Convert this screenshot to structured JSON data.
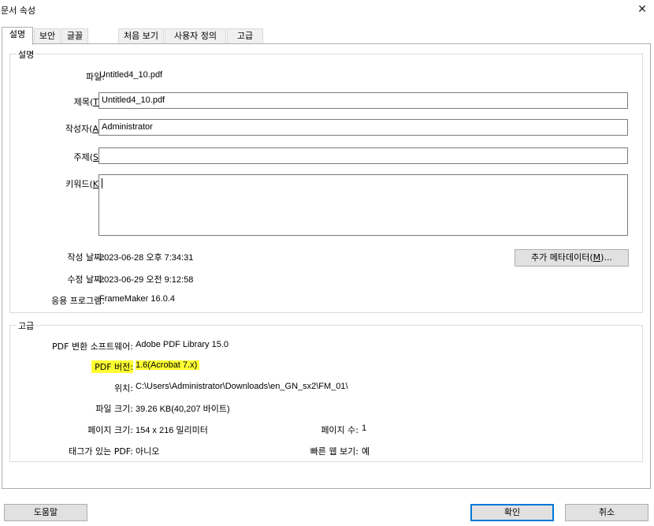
{
  "window": {
    "title": "문서 속성",
    "close_glyph": "✕"
  },
  "tabs": [
    {
      "label": "설명",
      "active": true
    },
    {
      "label": "보안"
    },
    {
      "label": "글꼴"
    },
    {
      "label": "처음 보기"
    },
    {
      "label": "사용자 정의"
    },
    {
      "label": "고급"
    }
  ],
  "description": {
    "group_title": "설명",
    "file_label": "파일:",
    "file_value": "Untitled4_10.pdf",
    "title_label_pre": "제목(",
    "title_label_key": "T",
    "title_label_post": "):",
    "title_value": "Untitled4_10.pdf",
    "author_label_pre": "작성자(",
    "author_label_key": "A",
    "author_label_post": "):",
    "author_value": "Administrator",
    "subject_label_pre": "주제(",
    "subject_label_key": "S",
    "subject_label_post": "):",
    "subject_value": "",
    "keywords_label_pre": "키워드(",
    "keywords_label_key": "K",
    "keywords_label_post": "):",
    "keywords_value": "",
    "created_label": "작성 날짜:",
    "created_value": "2023-06-28 오후 7:34:31",
    "modified_label": "수정 날짜:",
    "modified_value": "2023-06-29 오전 9:12:58",
    "app_label": "응용 프로그램:",
    "app_value": "FrameMaker 16.0.4",
    "metadata_btn_pre": "추가 메타데이터(",
    "metadata_btn_key": "M",
    "metadata_btn_post": ")..."
  },
  "advanced": {
    "group_title": "고급",
    "producer_label": "PDF 변환 소프트웨어:",
    "producer_value": "Adobe PDF Library 15.0",
    "version_label": "PDF 버전:",
    "version_value": "1.6(Acrobat 7.x)",
    "location_label": "위치:",
    "location_value": "C:\\Users\\Administrator\\Downloads\\en_GN_sx2\\FM_01\\",
    "filesize_label": "파일 크기:",
    "filesize_value": "39.26 KB(40,207 바이트)",
    "pagesize_label": "페이지 크기:",
    "pagesize_value": "154 x 216 밀리미터",
    "pagecount_label": "페이지 수:",
    "pagecount_value": "1",
    "tagged_label": "태그가 있는 PDF:",
    "tagged_value": "아니오",
    "fastweb_label": "빠른 웹 보기:",
    "fastweb_value": "예",
    "highlight_color": "#ffff33"
  },
  "footer": {
    "help_label": "도움말",
    "ok_label": "확인",
    "cancel_label": "취소"
  }
}
